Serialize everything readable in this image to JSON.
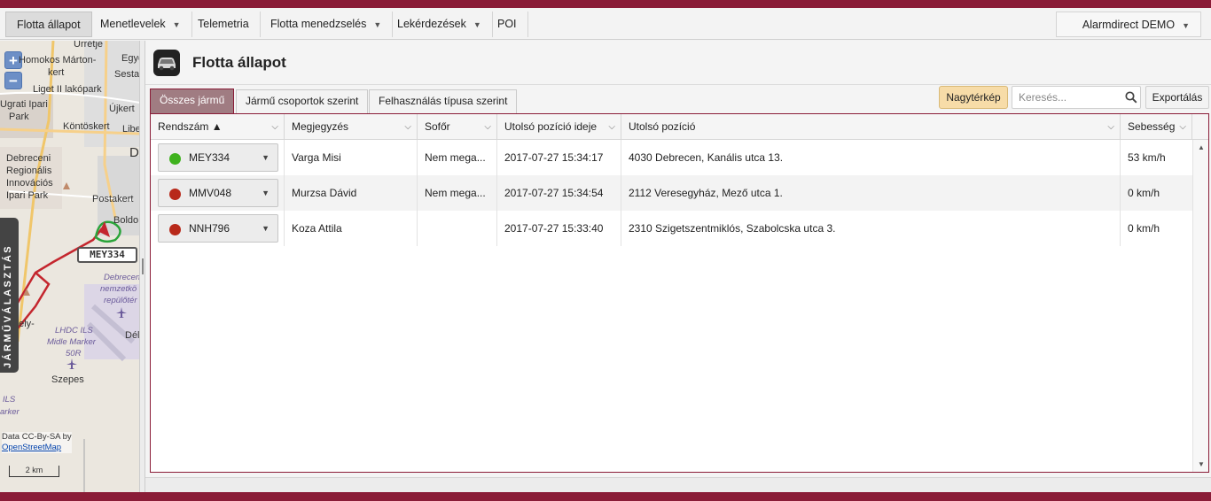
{
  "nav": {
    "items": [
      {
        "label": "Flotta állapot",
        "caret": false,
        "active": true
      },
      {
        "label": "Menetlevelek",
        "caret": true,
        "active": false
      },
      {
        "label": "Telemetria",
        "caret": false,
        "active": false
      },
      {
        "label": "Flotta menedzselés",
        "caret": true,
        "active": false
      },
      {
        "label": "Lekérdezések",
        "caret": true,
        "active": false
      },
      {
        "label": "POI",
        "caret": false,
        "active": false
      }
    ],
    "user": "Alarmdirect DEMO",
    "caret_glyph": "▼"
  },
  "map": {
    "zoom_in": "+",
    "zoom_out": "−",
    "labels": [
      "Urrétje",
      "Homokos Márton-",
      "kert",
      "Egye",
      "Sesta",
      "Liget II lakópark",
      "Újkert",
      "Ugrati Ipari",
      "Park",
      "Libe",
      "Köntöskert",
      "D",
      "Debreceni",
      "Regionális",
      "Innovációs",
      "Ipari Park",
      "Postakert",
      "Boldo",
      "Debrecen",
      "nemzetkö",
      "repülőtér",
      "Dél",
      "gely-",
      "LHDC ILS",
      "Midle Marker",
      "50R",
      "Szepes",
      "ILS",
      "arker"
    ],
    "vehicle_tag": "MEY334",
    "side_tab": "JÁRMŰVÁLASZTÁS",
    "attribution_text": "Data CC-By-SA by",
    "attribution_link": "OpenStreetMap",
    "scale": "2 km"
  },
  "header": {
    "title": "Flotta állapot"
  },
  "tabs": [
    {
      "label": "Összes jármű",
      "active": true
    },
    {
      "label": "Jármű csoportok szerint",
      "active": false
    },
    {
      "label": "Felhasználás típusa szerint",
      "active": false
    }
  ],
  "toolbar": {
    "big_map": "Nagytérkép",
    "search_placeholder": "Keresés...",
    "export": "Exportálás"
  },
  "grid": {
    "columns": [
      {
        "label": "Rendszám ▲"
      },
      {
        "label": "Megjegyzés"
      },
      {
        "label": "Sofőr"
      },
      {
        "label": "Utolsó pozíció ideje"
      },
      {
        "label": "Utolsó pozíció"
      },
      {
        "label": "Sebesség"
      }
    ],
    "chevron": "⌵",
    "rows": [
      {
        "plate": "MEY334",
        "status_color": "#3fb21e",
        "note": "Varga Misi",
        "driver": "Nem mega...",
        "time": "2017-07-27 15:34:17",
        "position": "4030 Debrecen, Kanális utca 13.",
        "speed": "53 km/h"
      },
      {
        "plate": "MMV048",
        "status_color": "#b8291a",
        "note": "Murzsa Dávid",
        "driver": "Nem mega...",
        "time": "2017-07-27 15:34:54",
        "position": "2112 Veresegyház, Mező utca 1.",
        "speed": "0 km/h"
      },
      {
        "plate": "NNH796",
        "status_color": "#b8291a",
        "note": "Koza Attila",
        "driver": "",
        "time": "2017-07-27 15:33:40",
        "position": "2310 Szigetszentmiklós, Szabolcska utca 3.",
        "speed": "0 km/h"
      }
    ]
  }
}
